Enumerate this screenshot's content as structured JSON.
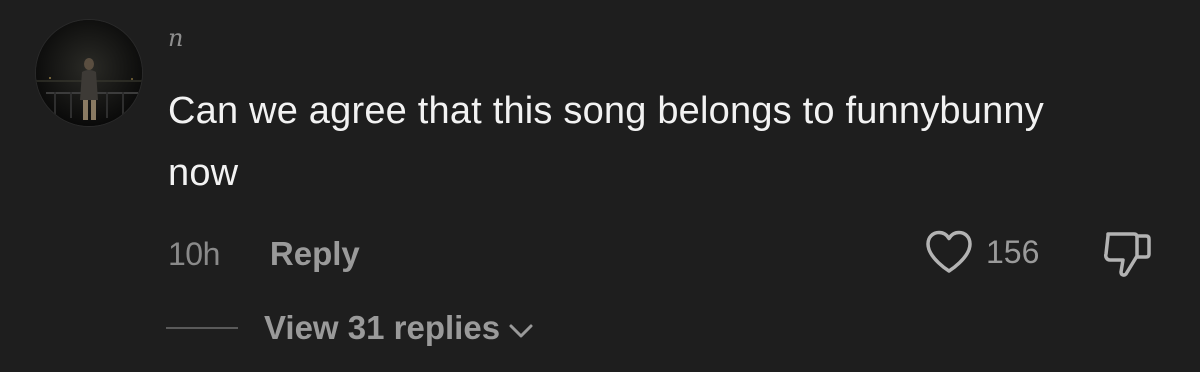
{
  "comment": {
    "username": "n",
    "text": "Can we agree that this song belongs to funnybunny now",
    "timestamp": "10h",
    "reply_label": "Reply",
    "like_count": "156",
    "view_replies_label": "View 31 replies"
  },
  "icons": {
    "like": "heart-icon",
    "dislike": "thumbs-down-icon",
    "expand": "chevron-down-icon"
  },
  "colors": {
    "background": "#1e1e1e",
    "text_primary": "#f2f2f2",
    "text_secondary": "#9a9a9a"
  }
}
